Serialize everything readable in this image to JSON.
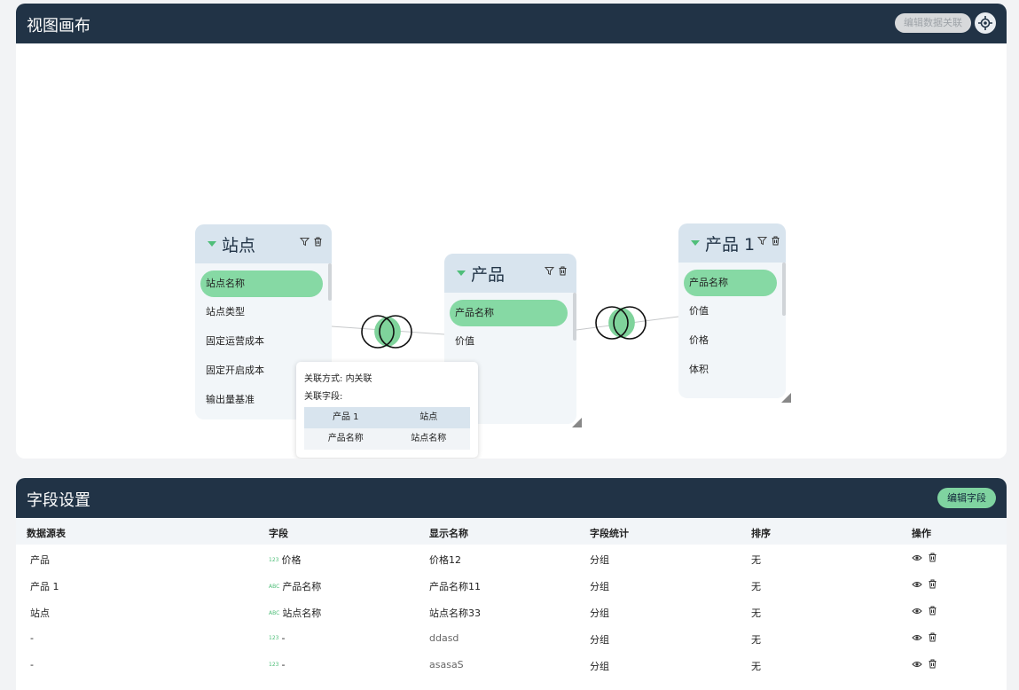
{
  "canvas": {
    "title": "视图画布",
    "edit_relation_label": "编辑数据关联",
    "nodes": [
      {
        "title": "站点",
        "fields": [
          "站点名称",
          "站点类型",
          "固定运营成本",
          "固定开启成本",
          "输出量基准"
        ]
      },
      {
        "title": "产品",
        "fields": [
          "产品名称",
          "价值"
        ]
      },
      {
        "title": "产品 1",
        "fields": [
          "产品名称",
          "价值",
          "价格",
          "体积"
        ]
      }
    ],
    "join_popup": {
      "method_label": "关联方式:",
      "method_value": "内关联",
      "fields_label": "关联字段:",
      "headers": [
        "产品 1",
        "站点"
      ],
      "row": [
        "产品名称",
        "站点名称"
      ]
    }
  },
  "fields": {
    "title": "字段设置",
    "edit_fields_label": "编辑字段",
    "columns": [
      "数据源表",
      "字段",
      "显示名称",
      "字段统计",
      "排序",
      "操作"
    ],
    "rows": [
      {
        "source": "产品",
        "type": "123",
        "field": "价格",
        "display": "价格12",
        "stat": "分组",
        "sort": "无"
      },
      {
        "source": "产品 1",
        "type": "ABC",
        "field": "产品名称",
        "display": "产品名称11",
        "stat": "分组",
        "sort": "无"
      },
      {
        "source": "站点",
        "type": "ABC",
        "field": "站点名称",
        "display": "站点名称33",
        "stat": "分组",
        "sort": "无"
      },
      {
        "source": "-",
        "type": "123",
        "field": "-",
        "display": "ddasd",
        "stat": "分组",
        "sort": "无"
      },
      {
        "source": "-",
        "type": "123",
        "field": "-",
        "display": "asasaS",
        "stat": "分组",
        "sort": "无"
      }
    ]
  },
  "colors": {
    "header": "#213346",
    "accent": "#86d9a4",
    "node_header": "#d8e4ee"
  }
}
